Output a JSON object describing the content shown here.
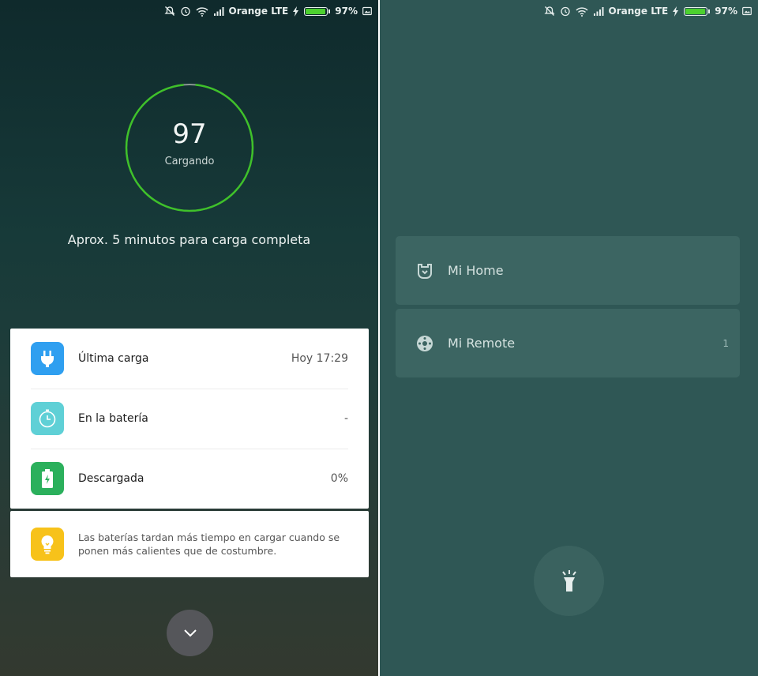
{
  "left_screen": {
    "statusbar": {
      "carrier": "Orange LTE",
      "battery_percent": "97%",
      "battery_level": 0.97
    },
    "charging": {
      "level": "97",
      "status": "Cargando",
      "eta": "Aprox. 5 minutos para carga completa",
      "ring_fraction": 0.97,
      "ring_color": "#3fc12a"
    },
    "info_rows": [
      {
        "icon": "plug-icon",
        "label": "Última carga",
        "value": "Hoy 17:29",
        "color": "#2f9ff0"
      },
      {
        "icon": "timer-icon",
        "label": "En la batería",
        "value": "-",
        "color": "#5fd0d6"
      },
      {
        "icon": "battery-icon",
        "label": "Descargada",
        "value": "0%",
        "color": "#2bb05c"
      }
    ],
    "tip": {
      "icon": "lightbulb-icon",
      "text": "Las baterías tardan más tiempo en cargar cuando se ponen más calientes que de costumbre.",
      "color": "#f7c21a"
    },
    "expand_button": {
      "icon": "chevron-down-icon"
    }
  },
  "right_screen": {
    "statusbar": {
      "carrier": "Orange LTE",
      "battery_percent": "97%",
      "battery_level": 0.97
    },
    "shortcuts": [
      {
        "icon": "mi-home-icon",
        "label": "Mi Home",
        "badge": ""
      },
      {
        "icon": "mi-remote-icon",
        "label": "Mi Remote",
        "badge": "1"
      }
    ],
    "flashlight_button": {
      "icon": "flashlight-icon"
    }
  }
}
